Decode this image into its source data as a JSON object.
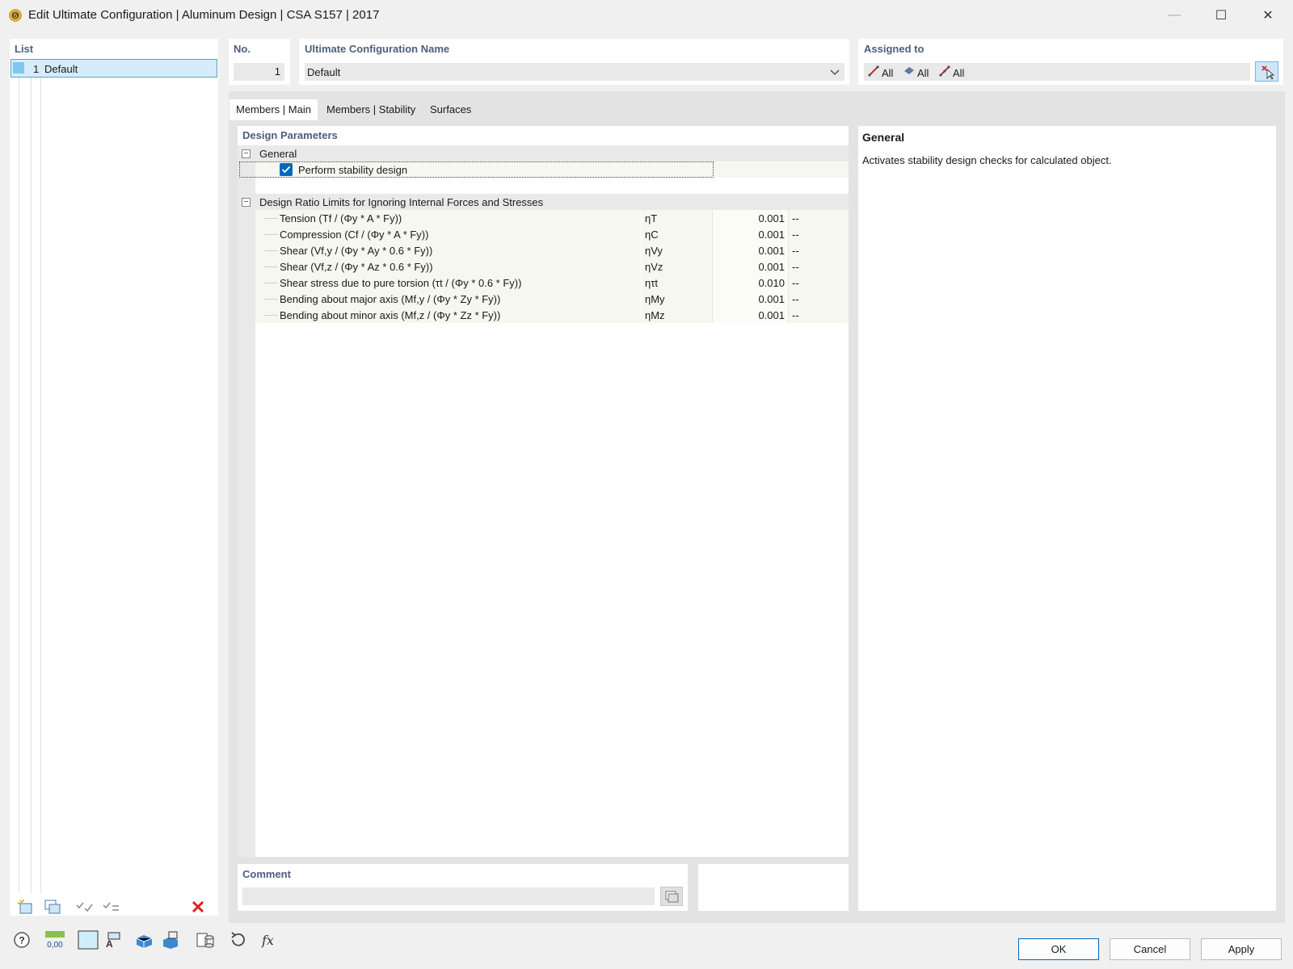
{
  "window": {
    "title": "Edit Ultimate Configuration | Aluminum Design | CSA S157 | 2017",
    "minimize": "—",
    "maximize": "☐",
    "close": "✕"
  },
  "list": {
    "header": "List",
    "items": [
      {
        "no": "1",
        "name": "Default",
        "color": "#7ec8f0"
      }
    ]
  },
  "no": {
    "header": "No.",
    "value": "1"
  },
  "config_name": {
    "header": "Ultimate Configuration Name",
    "value": "Default"
  },
  "assigned": {
    "header": "Assigned to",
    "items": [
      "All",
      "All",
      "All"
    ]
  },
  "tabs": [
    "Members | Main",
    "Members | Stability",
    "Surfaces"
  ],
  "design_params": {
    "header": "Design Parameters",
    "general_group": "General",
    "perform_stability": "Perform stability design",
    "ratio_group": "Design Ratio Limits for Ignoring Internal Forces and Stresses",
    "rows": [
      {
        "label": "Tension (Tf / (Φy * A * Fy))",
        "symbol": "ηT",
        "value": "0.001",
        "unit": "--"
      },
      {
        "label": "Compression (Cf / (Φy * A * Fy))",
        "symbol": "ηC",
        "value": "0.001",
        "unit": "--"
      },
      {
        "label": "Shear (Vf,y / (Φy * Ay * 0.6 * Fy))",
        "symbol": "ηVy",
        "value": "0.001",
        "unit": "--"
      },
      {
        "label": "Shear (Vf,z / (Φy * Az * 0.6 * Fy))",
        "symbol": "ηVz",
        "value": "0.001",
        "unit": "--"
      },
      {
        "label": "Shear stress due to pure torsion (τt / (Φy * 0.6 * Fy))",
        "symbol": "ητt",
        "value": "0.010",
        "unit": "--"
      },
      {
        "label": "Bending about major axis (Mf,y / (Φy * Zy * Fy))",
        "symbol": "ηMy",
        "value": "0.001",
        "unit": "--"
      },
      {
        "label": "Bending about minor axis (Mf,z / (Φy * Zz * Fy))",
        "symbol": "ηMz",
        "value": "0.001",
        "unit": "--"
      }
    ]
  },
  "info": {
    "header": "General",
    "text": "Activates stability design checks for calculated object."
  },
  "comment": {
    "header": "Comment",
    "value": ""
  },
  "buttons": {
    "ok": "OK",
    "cancel": "Cancel",
    "apply": "Apply"
  },
  "footer_tools": {
    "units_label": "0,00"
  },
  "colors": {
    "accent": "#0067c0",
    "header_text": "#4a5f7f",
    "selection": "#d6ecfa",
    "delete": "#e02020"
  }
}
